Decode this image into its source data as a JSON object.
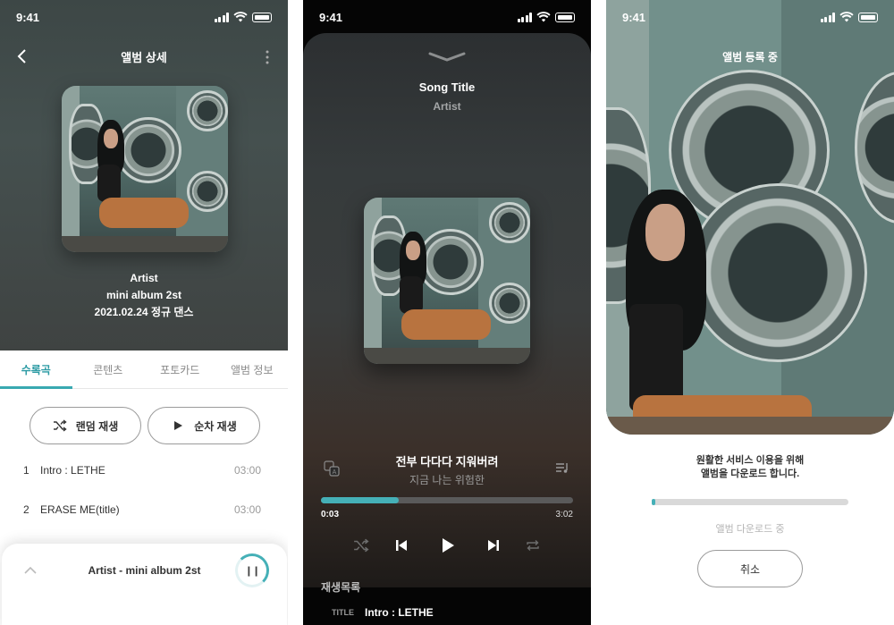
{
  "status_bar": {
    "time": "9:41"
  },
  "album_detail": {
    "title": "앨범 상세",
    "artist": "Artist",
    "album": "mini album 2st",
    "release": "2021.02.24 정규 댄스",
    "tabs": [
      {
        "label": "수록곡",
        "active": true
      },
      {
        "label": "콘텐츠",
        "active": false
      },
      {
        "label": "포토카드",
        "active": false
      },
      {
        "label": "앨범 정보",
        "active": false
      }
    ],
    "shuffle_label": "랜덤 재생",
    "sequential_label": "순차 재생",
    "tracks": [
      {
        "num": "1",
        "title": "Intro : LETHE",
        "duration": "03:00"
      },
      {
        "num": "2",
        "title": "ERASE ME(title)",
        "duration": "03:00"
      }
    ],
    "mini_player": {
      "title": "Artist - mini album 2st",
      "progress": 0.3
    }
  },
  "player": {
    "song_title": "Song Title",
    "artist": "Artist",
    "lyric_current": "전부 다다다 지워버려",
    "lyric_next": "지금 나는 위험한",
    "current_time": "0:03",
    "total_time": "3:02",
    "progress": 0.31,
    "queue_heading": "재생목록",
    "queue": [
      {
        "tag": "TITLE",
        "title": "Intro : LETHE"
      }
    ]
  },
  "registration": {
    "title": "앨범 등록 중",
    "message_line1": "원활한 서비스 이용을 위해",
    "message_line2": "앨범을 다운로드 합니다.",
    "progress": 0.02,
    "status": "앨범 다운로드 중",
    "cancel_label": "취소"
  },
  "colors": {
    "accent": "#45b0b7",
    "tab_active": "#2a9aa3"
  }
}
